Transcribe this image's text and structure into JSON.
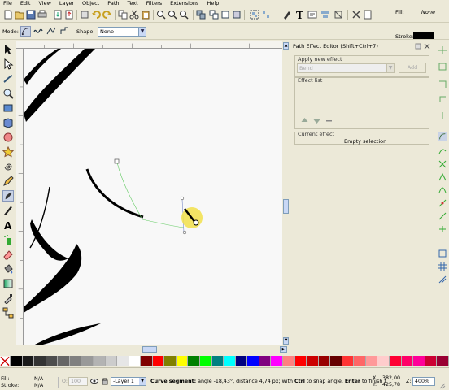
{
  "menu": [
    "File",
    "Edit",
    "View",
    "Layer",
    "Object",
    "Path",
    "Text",
    "Filters",
    "Extensions",
    "Help"
  ],
  "style_indicator": {
    "fill_label": "Fill:",
    "fill_value": "None",
    "stroke_label": "Stroke:"
  },
  "controls": {
    "mode_label": "Mode:",
    "shape_label": "Shape:",
    "shape_value": "None"
  },
  "dialog": {
    "title": "Path Effect Editor (Shift+Ctrl+7)",
    "apply_label": "Apply new effect",
    "effect_select": "Bend",
    "add_button": "Add",
    "effect_list_label": "Effect list",
    "current_effect_label": "Current effect",
    "current_effect_value": "Empty selection"
  },
  "status": {
    "fill_label": "Fill:",
    "fill_value": "N/A",
    "stroke_label": "Stroke:",
    "stroke_value": "N/A",
    "opacity_label": "O:",
    "opacity_value": "100",
    "layer": "-Layer 1",
    "message_bold": "Curve segment:",
    "message_1": " angle -18,43°, distance 4,74 px; with ",
    "ctrl": "Ctrl",
    "message_2": " to snap angle, ",
    "enter": "Enter",
    "message_3": " to finish t",
    "x_label": "X:",
    "x_value": "382,00",
    "y_label": "Y:",
    "y_value": "425,78",
    "zoom_label": "Z:",
    "zoom_value": "400%"
  },
  "palette_colors": [
    "#000000",
    "#1a1a1a",
    "#333333",
    "#4d4d4d",
    "#666666",
    "#808080",
    "#999999",
    "#b3b3b3",
    "#cccccc",
    "#e6e6e6",
    "#ffffff",
    "#800000",
    "#ff0000",
    "#808000",
    "#ffff00",
    "#008000",
    "#00ff00",
    "#008080",
    "#00ffff",
    "#000080",
    "#0000ff",
    "#800080",
    "#ff00ff",
    "#ff8080",
    "#ff0000",
    "#cc0000",
    "#990000",
    "#660000",
    "#ff3333",
    "#ff6666",
    "#ff9999",
    "#ffcccc",
    "#ff0033",
    "#ff0066",
    "#ff0099",
    "#cc0033",
    "#990033"
  ]
}
